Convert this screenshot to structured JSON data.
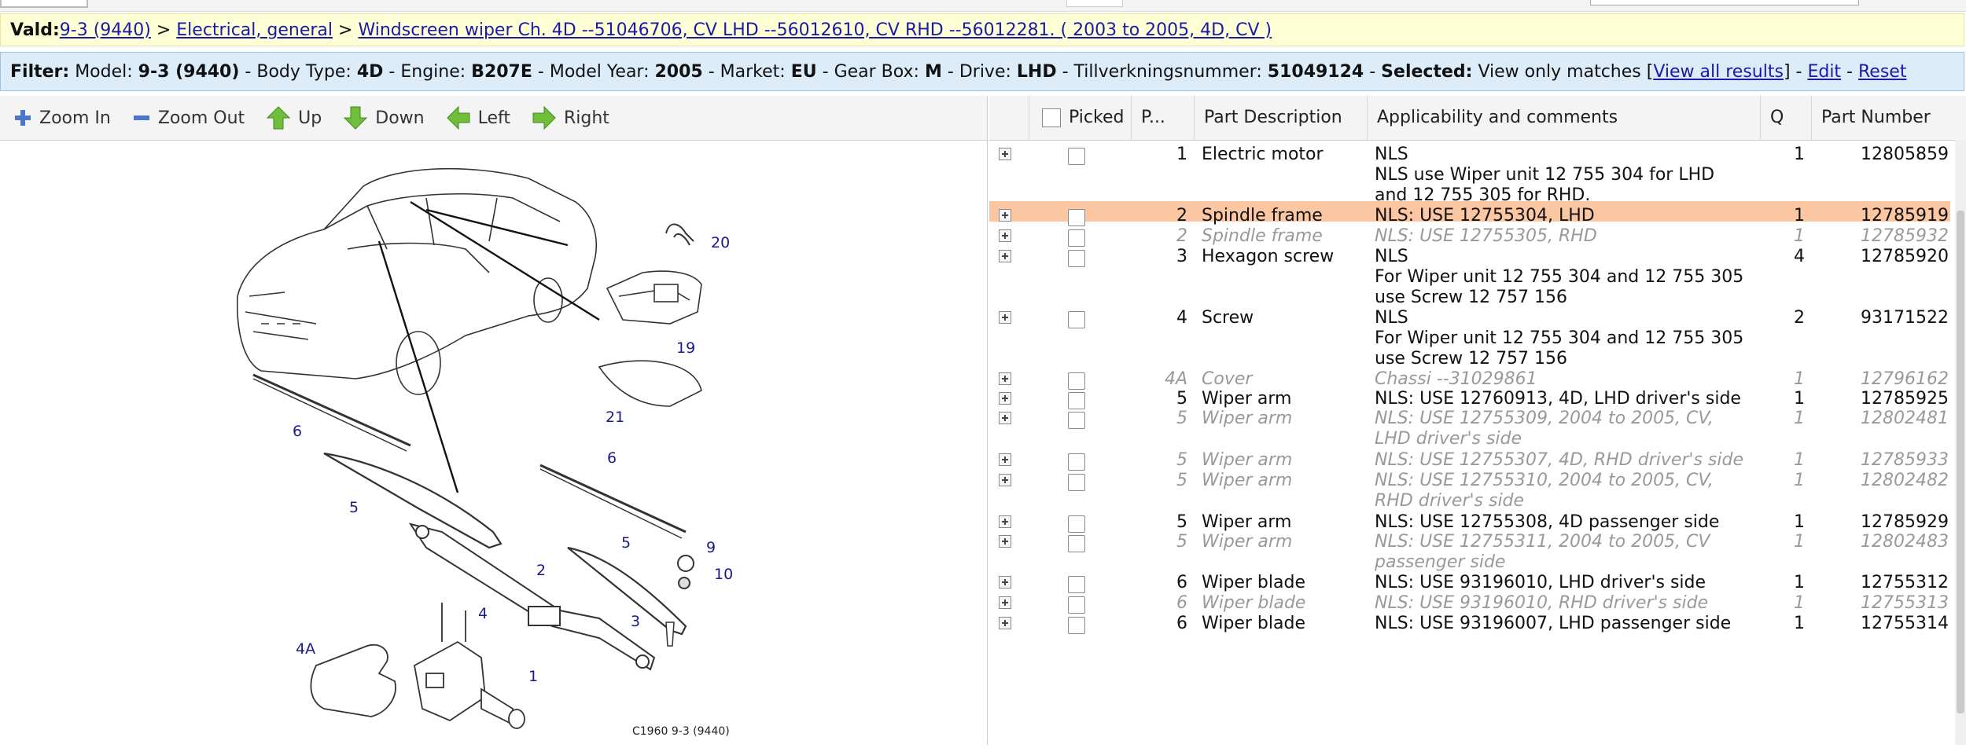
{
  "breadcrumb": {
    "label": "Vald:",
    "items": [
      "9-3 (9440)",
      "Electrical, general",
      "Windscreen wiper Ch. 4D --51046706, CV LHD --56012610, CV RHD --56012281. ( 2003 to 2005, 4D, CV )"
    ],
    "sep": " > "
  },
  "filter": {
    "prefix": "Filter:",
    "model_label": "Model:",
    "model_value": "9-3 (9440)",
    "body_label": "Body Type:",
    "body_value": "4D",
    "engine_label": "Engine:",
    "engine_value": "B207E",
    "year_label": "Model Year:",
    "year_value": "2005",
    "market_label": "Market:",
    "market_value": "EU",
    "gearbox_label": "Gear Box:",
    "gearbox_value": "M",
    "drive_label": "Drive:",
    "drive_value": "LHD",
    "tillv_label": "Tillverkningsnummer:",
    "tillv_value": "51049124",
    "selected_label": "Selected:",
    "selected_value": "View only matches",
    "view_all": "View all results",
    "edit": "Edit",
    "reset": "Reset"
  },
  "toolbar": {
    "zoom_in": "Zoom In",
    "zoom_out": "Zoom Out",
    "up": "Up",
    "down": "Down",
    "left": "Left",
    "right": "Right"
  },
  "grid": {
    "headers": {
      "picked": "Picked",
      "pos": "P...",
      "desc": "Part Description",
      "app": "Applicability and comments",
      "qty": "Q",
      "pn": "Part Number"
    },
    "rows": [
      {
        "pos": "1",
        "desc": "Electric motor",
        "app": "NLS\nNLS use Wiper unit 12 755 304 for LHD and 12 755 305 for RHD.",
        "qty": "1",
        "pn": "12805859"
      },
      {
        "pos": "2",
        "desc": "Spindle frame",
        "app": "NLS: USE 12755304, LHD",
        "qty": "1",
        "pn": "12785919"
      },
      {
        "pos": "2",
        "desc": "Spindle frame",
        "app": "NLS: USE 12755305, RHD",
        "qty": "1",
        "pn": "12785932"
      },
      {
        "pos": "3",
        "desc": "Hexagon screw",
        "app": "NLS\nFor Wiper unit 12 755 304 and 12 755 305 use Screw 12 757 156",
        "qty": "4",
        "pn": "12785920"
      },
      {
        "pos": "4",
        "desc": "Screw",
        "app": "NLS\nFor Wiper unit 12 755 304 and 12 755 305 use Screw 12 757 156",
        "qty": "2",
        "pn": "93171522"
      },
      {
        "pos": "4A",
        "desc": "Cover",
        "app": "Chassi --31029861",
        "qty": "1",
        "pn": "12796162"
      },
      {
        "pos": "5",
        "desc": "Wiper arm",
        "app": "NLS: USE 12760913, 4D, LHD driver's side",
        "qty": "1",
        "pn": "12785925"
      },
      {
        "pos": "5",
        "desc": "Wiper arm",
        "app": "NLS: USE 12755309, 2004 to 2005, CV, LHD driver's side",
        "qty": "1",
        "pn": "12802481"
      },
      {
        "pos": "5",
        "desc": "Wiper arm",
        "app": "NLS: USE 12755307, 4D, RHD driver's side",
        "qty": "1",
        "pn": "12785933"
      },
      {
        "pos": "5",
        "desc": "Wiper arm",
        "app": "NLS: USE 12755310, 2004 to 2005, CV, RHD driver's side",
        "qty": "1",
        "pn": "12802482"
      },
      {
        "pos": "5",
        "desc": "Wiper arm",
        "app": "NLS: USE 12755308, 4D passenger side",
        "qty": "1",
        "pn": "12785929"
      },
      {
        "pos": "5",
        "desc": "Wiper arm",
        "app": "NLS: USE 12755311, 2004 to 2005, CV passenger side",
        "qty": "1",
        "pn": "12802483"
      },
      {
        "pos": "6",
        "desc": "Wiper blade",
        "app": "NLS: USE 93196010, LHD driver's side",
        "qty": "1",
        "pn": "12755312"
      },
      {
        "pos": "6",
        "desc": "Wiper blade",
        "app": "NLS: USE 93196010, RHD driver's side",
        "qty": "1",
        "pn": "12755313"
      },
      {
        "pos": "6",
        "desc": "Wiper blade",
        "app": "NLS: USE 93196007, LHD passenger side",
        "qty": "1",
        "pn": "12755314"
      }
    ]
  },
  "diagram": {
    "caption": "C1960 9-3 (9440)",
    "callouts": [
      "20",
      "19",
      "21",
      "6",
      "6",
      "5",
      "5",
      "9",
      "10",
      "2",
      "3",
      "4",
      "4A",
      "1"
    ]
  },
  "colors": {
    "highlight_row": "#fbc7a3",
    "breadcrumb_bg": "#ffffd6",
    "filter_bg": "#dcecf8",
    "link": "#1a1aa8"
  }
}
